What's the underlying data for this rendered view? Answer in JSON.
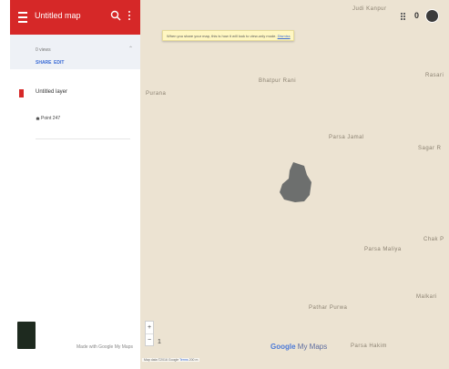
{
  "app": {
    "title": "Untitled map"
  },
  "map_info": {
    "views": "0 views",
    "share_label": "SHARE",
    "edit_label": "EDIT"
  },
  "layer": {
    "title": "Untitled layer",
    "place": "Point 247"
  },
  "footer": {
    "made_with": "Made with Google My Maps"
  },
  "map": {
    "notice_text": "When you share your map, this is how it will look to view-only mode.",
    "notice_link": "Dismiss",
    "labels": {
      "judi_kanpur": "Judi Kanpur",
      "bhatpur_rani": "Bhatpur Rani",
      "purana": "Purana",
      "rasari": "Rasari",
      "parsa_jamal": "Parsa Jamal",
      "sagar_r": "Sagar R",
      "chak_p": "Chak P",
      "parsa_maliya": "Parsa Maliya",
      "malkari": "Malkari",
      "pathar_purwa": "Pathar Purwa",
      "parsa_hakim": "Parsa Hakim"
    },
    "zoom_in": "+",
    "zoom_out": "−",
    "zoom_level": "1",
    "logo_google": "Google",
    "logo_mymaps": " My Maps",
    "attribution": "Map data ©2016 Google",
    "terms": "Terms",
    "scale": "200 m",
    "notification_count": "0",
    "polygon_color": "#6d6f6e"
  },
  "colors": {
    "brand_red": "#d62828",
    "map_background": "#ece3d2",
    "link_blue": "#3a6bd6"
  }
}
